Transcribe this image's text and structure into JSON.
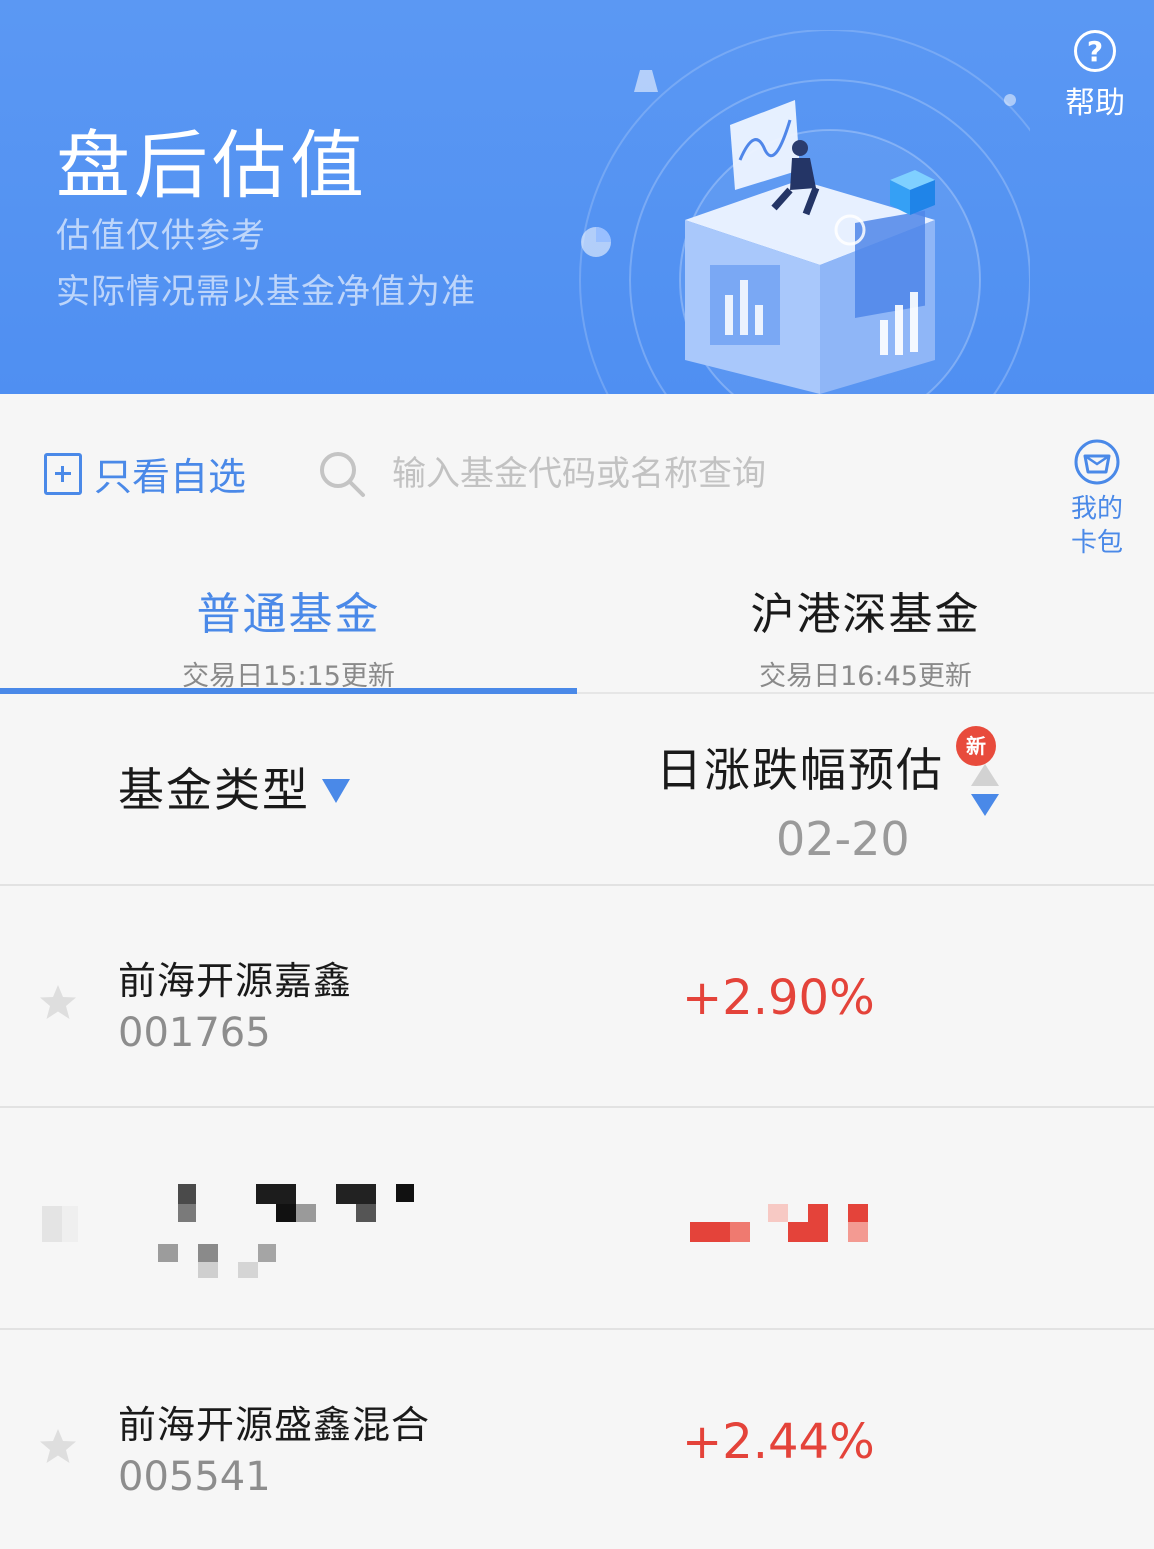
{
  "banner": {
    "title": "盘后估值",
    "subtitle_1": "估值仅供参考",
    "subtitle_2": "实际情况需以基金净值为准",
    "help_label": "帮助",
    "illustration": "data-analysis-illustration"
  },
  "toolbar": {
    "mine_only_label": "只看自选",
    "search_placeholder": "输入基金代码或名称查询",
    "wallet_label_1": "我的",
    "wallet_label_2": "卡包"
  },
  "tabs": [
    {
      "title": "普通基金",
      "subtitle": "交易日15:15更新",
      "active": true
    },
    {
      "title": "沪港深基金",
      "subtitle": "交易日16:45更新",
      "active": false
    }
  ],
  "table_header": {
    "type_label": "基金类型",
    "change_label": "日涨跌幅预估",
    "new_badge": "新",
    "date": "02-20"
  },
  "funds": [
    {
      "name": "前海开源嘉鑫",
      "code": "001765",
      "change": "+2.90%",
      "favorite": false
    },
    {
      "name": "",
      "code": "",
      "change": "",
      "favorite": false,
      "pixelated": true
    },
    {
      "name": "前海开源盛鑫混合",
      "code": "005541",
      "change": "+2.44%",
      "favorite": false
    }
  ],
  "colors": {
    "brand_blue": "#4a89e8",
    "banner_blue": "#5b98f3",
    "rise_red": "#e4433a",
    "background": "#f6f6f6"
  },
  "icons": [
    "help-icon",
    "add-to-watchlist-icon",
    "search-icon",
    "wallet-icon",
    "dropdown-triangle-icon",
    "sort-up-icon",
    "sort-down-icon",
    "star-icon"
  ]
}
